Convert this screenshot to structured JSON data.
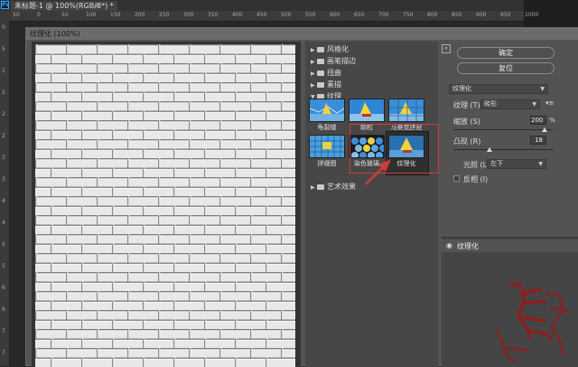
{
  "app": {
    "doc_tab": "未标题-1 @ 100%(RGB/8*) *",
    "doc_close": "×",
    "ps_logo": "Ps"
  },
  "ruler": {
    "top_ticks": [
      "50",
      "0",
      "50",
      "100",
      "150",
      "200",
      "250",
      "300",
      "350",
      "400",
      "450",
      "500",
      "550",
      "600",
      "650",
      "700",
      "750",
      "800",
      "850",
      "900",
      "950",
      "1000"
    ],
    "left_ticks": [
      "0",
      "5",
      "1",
      "1",
      "2",
      "2",
      "3",
      "3",
      "4",
      "4",
      "5",
      "5",
      "6",
      "6",
      "7",
      "7"
    ]
  },
  "dialog": {
    "title": "纹理化 (100%)"
  },
  "filter_tree": {
    "folders": [
      {
        "label": "风格化",
        "expanded": false
      },
      {
        "label": "画笔描边",
        "expanded": false
      },
      {
        "label": "扭曲",
        "expanded": false
      },
      {
        "label": "素描",
        "expanded": false
      },
      {
        "label": "纹理",
        "expanded": true
      }
    ],
    "thumbnails": [
      {
        "label": "龟裂缝"
      },
      {
        "label": "颗粒"
      },
      {
        "label": "马赛克拼贴"
      },
      {
        "label": "拼缀图"
      },
      {
        "label": "染色玻璃"
      },
      {
        "label": "纹理化",
        "selected": true
      }
    ],
    "after_folder": {
      "label": "艺术效果",
      "expanded": false
    }
  },
  "settings": {
    "collapse_icon": "«",
    "ok_label": "确定",
    "reset_label": "复位",
    "filter_select": "纹理化",
    "texture_label": "纹理 (T):",
    "texture_value": "砖形",
    "texture_menu_icon": "▾≡",
    "scaling_label": "缩放 (S)",
    "scaling_value": "200",
    "scaling_unit": "%",
    "scaling_fraction": 0.92,
    "relief_label": "凸现 (R)",
    "relief_value": "18",
    "relief_fraction": 0.36,
    "light_label": "光照 (L):",
    "light_value": "左下",
    "invert_label": "反相 (I)",
    "invert_checked": false
  },
  "effect_layers": {
    "items": [
      {
        "label": "纹理化",
        "visible": true
      }
    ]
  },
  "colors": {
    "accent_red": "#d33b3b",
    "dialog_bg": "#535353",
    "panel_bg": "#474747"
  }
}
